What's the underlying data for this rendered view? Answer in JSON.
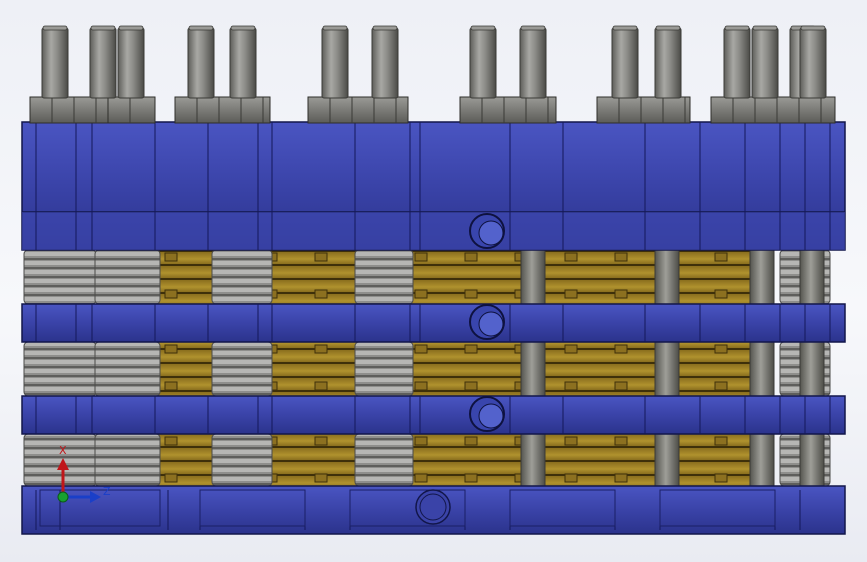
{
  "viewport": {
    "background": "#f2f3f8"
  },
  "model": {
    "colors": {
      "plate": "#3a43a8",
      "plate_light": "#4c58c4",
      "plate_dark": "#1d2370",
      "plate_edge": "#12164a",
      "gold": "#a88a2a",
      "gold_dark": "#5b4612",
      "spring": "#9a9a9a",
      "spring_dark": "#5a5a5a",
      "bolt": "#8c8c88",
      "bolt_dark": "#4a4a46"
    }
  },
  "triad": {
    "x_label": "X",
    "z_label": "Z",
    "x_color": "#c0161a",
    "z_color": "#1a3fc8",
    "y_color": "#18a030"
  }
}
